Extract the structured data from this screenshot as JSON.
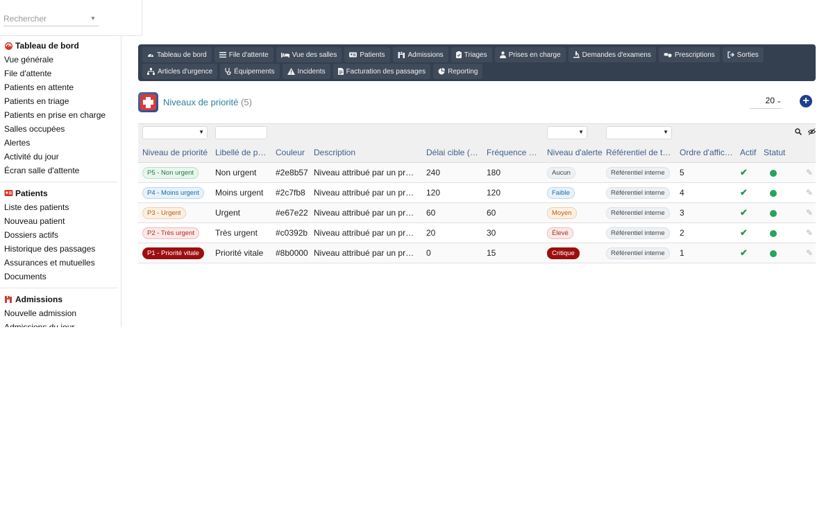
{
  "sidebar": {
    "search_placeholder": "Rechercher",
    "sections": [
      {
        "title": "Tableau de bord",
        "icon": "dashboard-icon",
        "items": [
          "Vue générale",
          "File d'attente",
          "Patients en attente",
          "Patients en triage",
          "Patients en prise en charge",
          "Salles occupées",
          "Alertes",
          "Activité du jour",
          "Écran salle d'attente"
        ]
      },
      {
        "title": "Patients",
        "icon": "patients-card-icon",
        "items": [
          "Liste des patients",
          "Nouveau patient",
          "Dossiers actifs",
          "Historique des passages",
          "Assurances et mutuelles",
          "Documents"
        ]
      },
      {
        "title": "Admissions",
        "icon": "admissions-icon",
        "items": [
          "Nouvelle admission",
          "Admissions du jour"
        ]
      }
    ]
  },
  "toolbar": {
    "row1": [
      {
        "label": "Tableau de bord",
        "icon": "dashboard-icon"
      },
      {
        "label": "File d'attente",
        "icon": "list-icon"
      },
      {
        "label": "Vue des salles",
        "icon": "bed-icon"
      },
      {
        "label": "Patients",
        "icon": "id-card-icon"
      },
      {
        "label": "Admissions",
        "icon": "admission-icon"
      },
      {
        "label": "Triages",
        "icon": "clipboard-icon"
      },
      {
        "label": "Prises en charge",
        "icon": "doctor-icon"
      },
      {
        "label": "Demandes d'examens",
        "icon": "exam-icon"
      },
      {
        "label": "Prescriptions",
        "icon": "pills-icon"
      },
      {
        "label": "Sorties",
        "icon": "exit-icon"
      }
    ],
    "row2": [
      {
        "label": "Articles d'urgence",
        "icon": "sitemap-icon"
      },
      {
        "label": "Équipements",
        "icon": "stethoscope-icon"
      },
      {
        "label": "Incidents",
        "icon": "warning-icon"
      },
      {
        "label": "Facturation des passages",
        "icon": "invoice-icon"
      },
      {
        "label": "Reporting",
        "icon": "chart-pie-icon"
      }
    ]
  },
  "header": {
    "title": "Niveaux de priorité",
    "count": "(5)",
    "page_size": "20"
  },
  "table": {
    "columns": [
      "Niveau de priorité",
      "Libellé de pri…",
      "Couleur",
      "Description",
      "Délai cible (…",
      "Fréquence d…",
      "Niveau d'alerte",
      "Référentiel de tri…",
      "Ordre d'affic…",
      "Actif",
      "Statut"
    ],
    "rows": [
      {
        "niveau": "P5 - Non urgent",
        "libelle": "Non urgent",
        "couleur": "#2e8b57",
        "description": "Niveau attribué par un professionnel de santé",
        "delai": "240",
        "frequence": "180",
        "alerte": "Aucun",
        "referentiel": "Référentiel interne",
        "ordre": "5",
        "niveau_style": "green",
        "alerte_style": "neutral"
      },
      {
        "niveau": "P4 - Moins urgent",
        "libelle": "Moins urgent",
        "couleur": "#2c7fb8",
        "description": "Niveau attribué par un professionnel de santé",
        "delai": "120",
        "frequence": "120",
        "alerte": "Faible",
        "referentiel": "Référentiel interne",
        "ordre": "4",
        "niveau_style": "blue",
        "alerte_style": "blue"
      },
      {
        "niveau": "P3 - Urgent",
        "libelle": "Urgent",
        "couleur": "#e67e22",
        "description": "Niveau attribué par un professionnel de santé",
        "delai": "60",
        "frequence": "60",
        "alerte": "Moyen",
        "referentiel": "Référentiel interne",
        "ordre": "3",
        "niveau_style": "orange",
        "alerte_style": "orange"
      },
      {
        "niveau": "P2 - Très urgent",
        "libelle": "Très urgent",
        "couleur": "#c0392b",
        "description": "Niveau attribué par un professionnel de santé",
        "delai": "20",
        "frequence": "30",
        "alerte": "Élevé",
        "referentiel": "Référentiel interne",
        "ordre": "2",
        "niveau_style": "red",
        "alerte_style": "red"
      },
      {
        "niveau": "P1 - Priorité vitale",
        "libelle": "Priorité vitale",
        "couleur": "#8b0000",
        "description": "Niveau attribué par un professionnel de santé",
        "delai": "0",
        "frequence": "15",
        "alerte": "Critique",
        "referentiel": "Référentiel interne",
        "ordre": "1",
        "niveau_style": "dark",
        "alerte_style": "dark"
      }
    ]
  },
  "colors": {
    "toolbar_bg": "#34404f",
    "title_blue": "#2b7fa3",
    "header_text": "#3d5f8c",
    "active_green": "#27965a",
    "add_button": "#1d3f8f"
  }
}
